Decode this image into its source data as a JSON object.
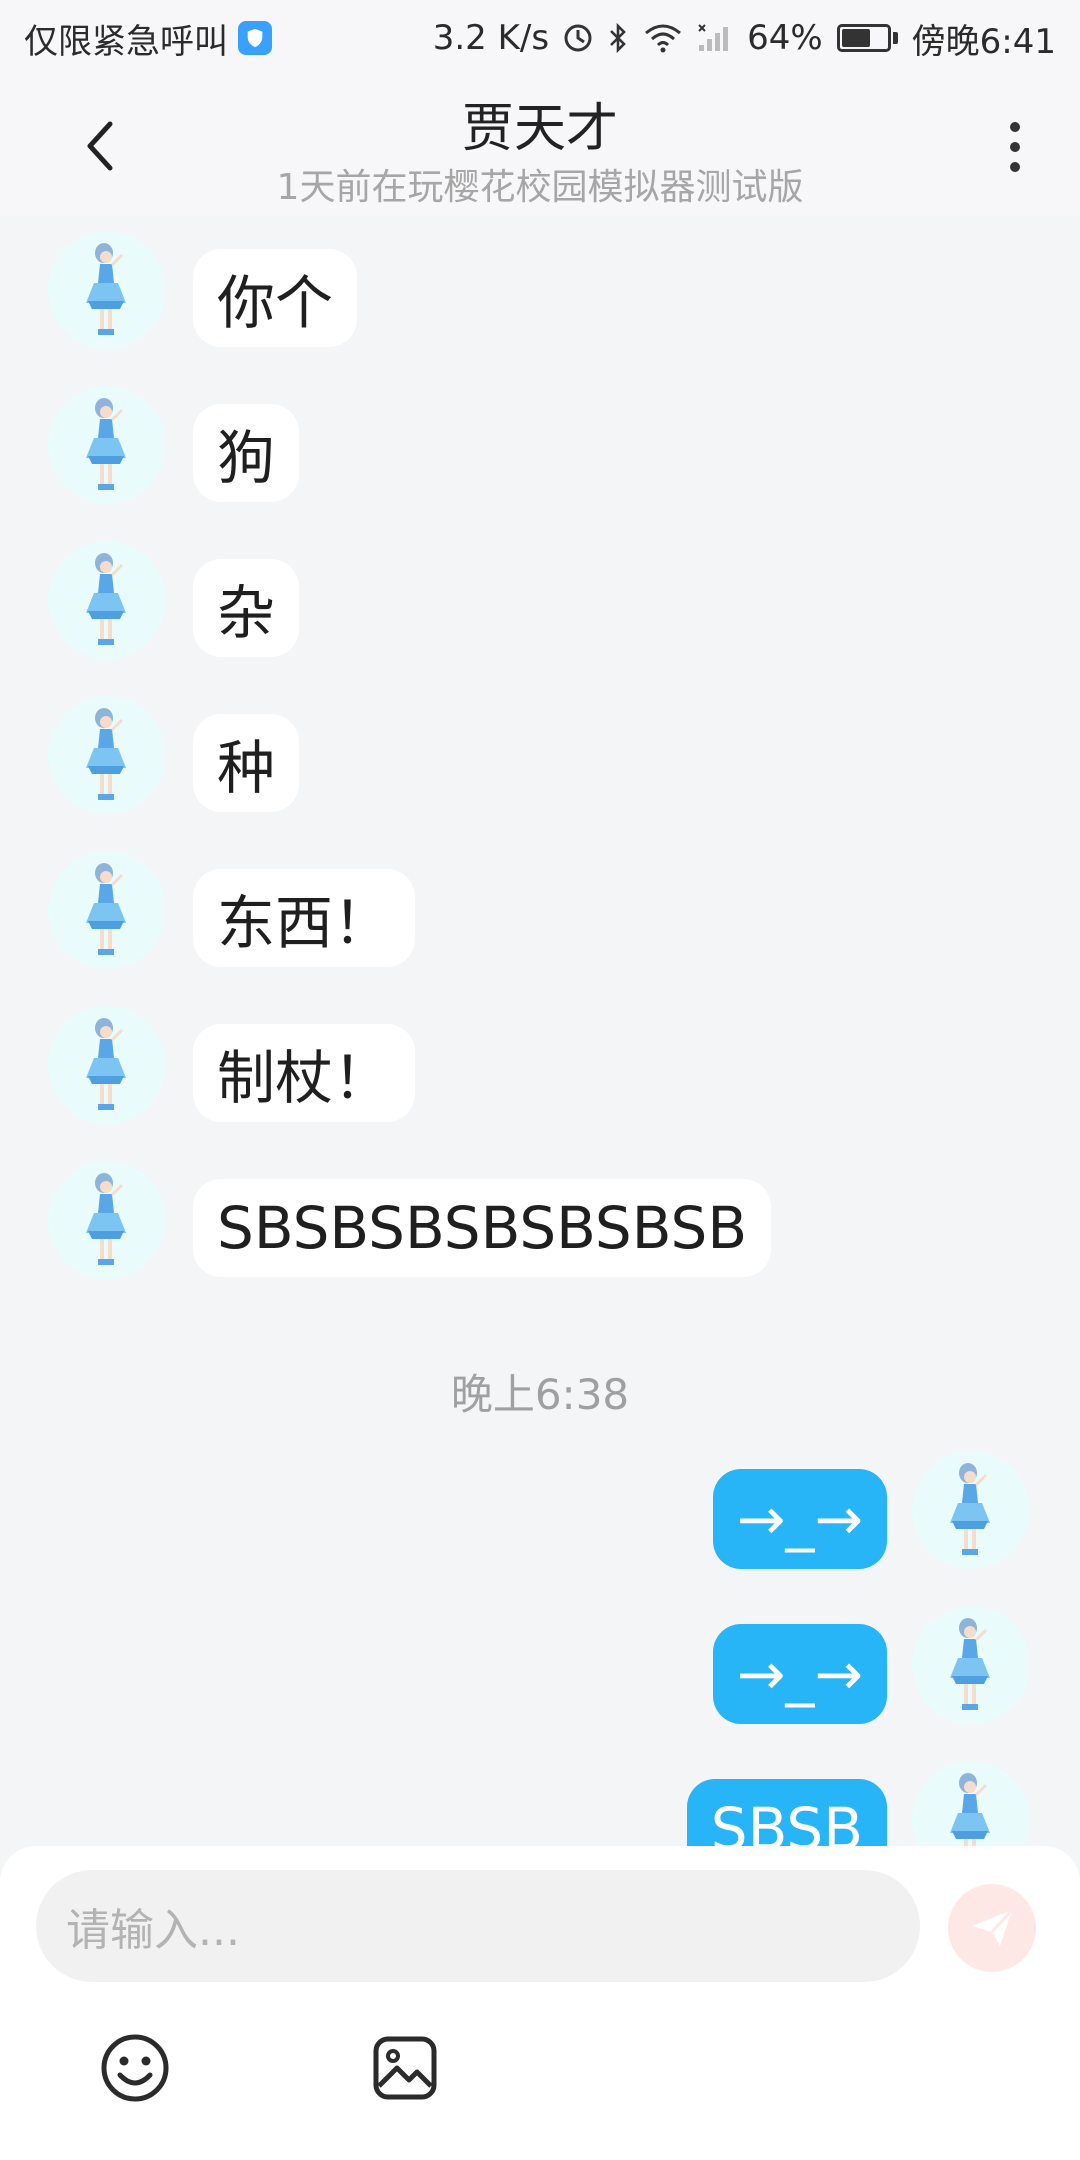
{
  "status_bar": {
    "carrier": "仅限紧急呼叫",
    "speed": "3.2 K/s",
    "battery_percent": "64%",
    "battery_level": 0.64,
    "time": "傍晚6:41"
  },
  "header": {
    "title": "贾天才",
    "subtitle": "1天前在玩樱花校园模拟器测试版"
  },
  "messages_received": [
    {
      "text": "你个"
    },
    {
      "text": "狗"
    },
    {
      "text": "杂"
    },
    {
      "text": "种"
    },
    {
      "text": "东西！"
    },
    {
      "text": "制杖！"
    },
    {
      "text": "SBSBSBSBSBSBSB"
    }
  ],
  "timestamp": "晚上6:38",
  "messages_sent": [
    {
      "text": "→_→"
    },
    {
      "text": "→_→"
    },
    {
      "text": "SBSB"
    }
  ],
  "composer": {
    "placeholder": "请输入..."
  },
  "colors": {
    "accent": "#27b5f7",
    "background": "#f4f5f7",
    "send_button": "#fde8e6"
  },
  "icons": [
    "back-arrow-icon",
    "more-vertical-icon",
    "send-icon",
    "emoji-icon",
    "image-icon",
    "shield-icon",
    "bluetooth-icon",
    "wifi-icon",
    "signal-icon",
    "battery-icon"
  ]
}
